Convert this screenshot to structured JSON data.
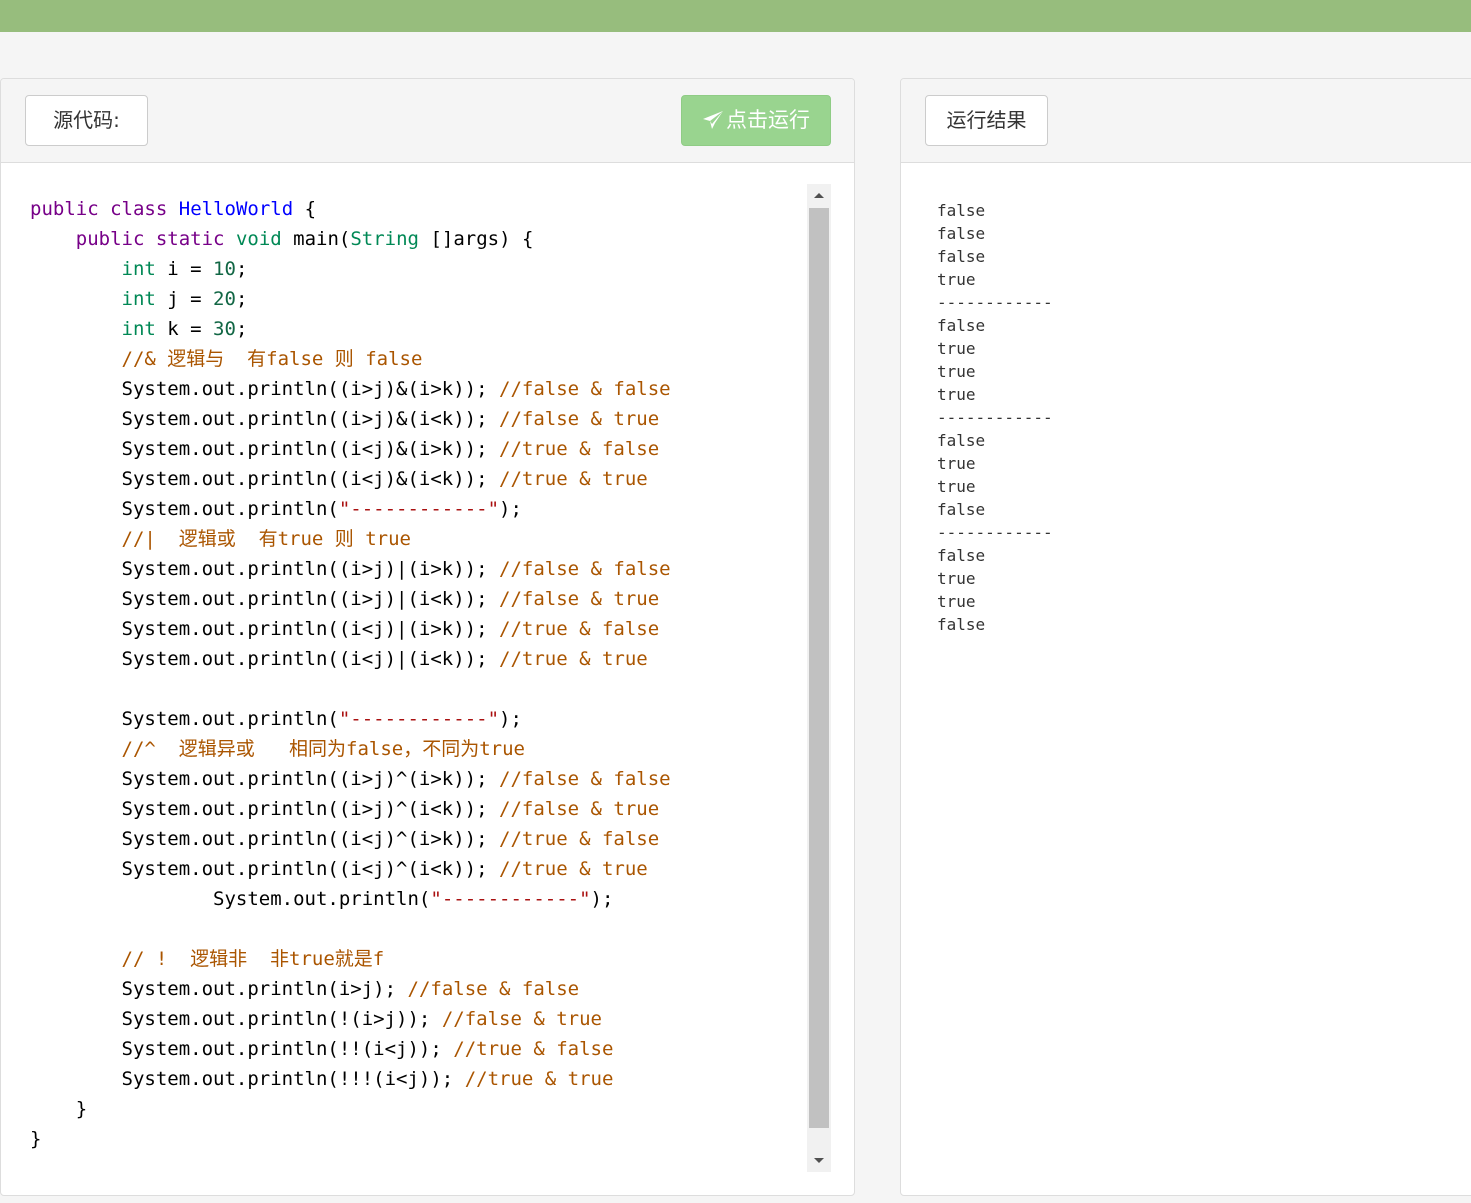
{
  "header": {
    "title": ""
  },
  "source_panel": {
    "label": "源代码:",
    "run_button": {
      "label": "点击运行",
      "icon": "paper-plane-icon"
    }
  },
  "result_panel": {
    "label": "运行结果"
  },
  "code_lines": [
    [
      [
        "k",
        "public"
      ],
      [
        "p",
        " "
      ],
      [
        "k",
        "class"
      ],
      [
        "p",
        " "
      ],
      [
        "d",
        "HelloWorld"
      ],
      [
        "p",
        " {"
      ]
    ],
    [
      [
        "p",
        "    "
      ],
      [
        "k",
        "public"
      ],
      [
        "p",
        " "
      ],
      [
        "k",
        "static"
      ],
      [
        "p",
        " "
      ],
      [
        "t",
        "void"
      ],
      [
        "p",
        " main("
      ],
      [
        "t",
        "String"
      ],
      [
        "p",
        " []args) {"
      ]
    ],
    [
      [
        "p",
        "        "
      ],
      [
        "t",
        "int"
      ],
      [
        "p",
        " i = "
      ],
      [
        "n",
        "10"
      ],
      [
        "p",
        ";"
      ]
    ],
    [
      [
        "p",
        "        "
      ],
      [
        "t",
        "int"
      ],
      [
        "p",
        " j = "
      ],
      [
        "n",
        "20"
      ],
      [
        "p",
        ";"
      ]
    ],
    [
      [
        "p",
        "        "
      ],
      [
        "t",
        "int"
      ],
      [
        "p",
        " k = "
      ],
      [
        "n",
        "30"
      ],
      [
        "p",
        ";"
      ]
    ],
    [
      [
        "p",
        "        "
      ],
      [
        "c",
        "//& 逻辑与  有false 则 false"
      ]
    ],
    [
      [
        "p",
        "        System.out.println((i>j)&(i>k)); "
      ],
      [
        "c",
        "//false & false"
      ]
    ],
    [
      [
        "p",
        "        System.out.println((i>j)&(i<k)); "
      ],
      [
        "c",
        "//false & true"
      ]
    ],
    [
      [
        "p",
        "        System.out.println((i<j)&(i>k)); "
      ],
      [
        "c",
        "//true & false"
      ]
    ],
    [
      [
        "p",
        "        System.out.println((i<j)&(i<k)); "
      ],
      [
        "c",
        "//true & true"
      ]
    ],
    [
      [
        "p",
        "        System.out.println("
      ],
      [
        "s",
        "\"------------\""
      ],
      [
        "p",
        ");"
      ]
    ],
    [
      [
        "p",
        "        "
      ],
      [
        "c",
        "//|  逻辑或  有true 则 true"
      ]
    ],
    [
      [
        "p",
        "        System.out.println((i>j)|(i>k)); "
      ],
      [
        "c",
        "//false & false"
      ]
    ],
    [
      [
        "p",
        "        System.out.println((i>j)|(i<k)); "
      ],
      [
        "c",
        "//false & true"
      ]
    ],
    [
      [
        "p",
        "        System.out.println((i<j)|(i>k)); "
      ],
      [
        "c",
        "//true & false"
      ]
    ],
    [
      [
        "p",
        "        System.out.println((i<j)|(i<k)); "
      ],
      [
        "c",
        "//true & true"
      ]
    ],
    [
      [
        "p",
        ""
      ]
    ],
    [
      [
        "p",
        "        System.out.println("
      ],
      [
        "s",
        "\"------------\""
      ],
      [
        "p",
        ");"
      ]
    ],
    [
      [
        "p",
        "        "
      ],
      [
        "c",
        "//^  逻辑异或   相同为false，不同为true"
      ]
    ],
    [
      [
        "p",
        "        System.out.println((i>j)^(i>k)); "
      ],
      [
        "c",
        "//false & false"
      ]
    ],
    [
      [
        "p",
        "        System.out.println((i>j)^(i<k)); "
      ],
      [
        "c",
        "//false & true"
      ]
    ],
    [
      [
        "p",
        "        System.out.println((i<j)^(i>k)); "
      ],
      [
        "c",
        "//true & false"
      ]
    ],
    [
      [
        "p",
        "        System.out.println((i<j)^(i<k)); "
      ],
      [
        "c",
        "//true & true"
      ]
    ],
    [
      [
        "p",
        "                System.out.println("
      ],
      [
        "s",
        "\"------------\""
      ],
      [
        "p",
        ");"
      ]
    ],
    [
      [
        "p",
        ""
      ]
    ],
    [
      [
        "p",
        "        "
      ],
      [
        "c",
        "// !  逻辑非  非true就是f"
      ]
    ],
    [
      [
        "p",
        "        System.out.println(i>j); "
      ],
      [
        "c",
        "//false & false"
      ]
    ],
    [
      [
        "p",
        "        System.out.println(!(i>j)); "
      ],
      [
        "c",
        "//false & true"
      ]
    ],
    [
      [
        "p",
        "        System.out.println(!!(i<j)); "
      ],
      [
        "c",
        "//true & false"
      ]
    ],
    [
      [
        "p",
        "        System.out.println(!!!(i<j)); "
      ],
      [
        "c",
        "//true & true"
      ]
    ],
    [
      [
        "p",
        "    }"
      ]
    ],
    [
      [
        "p",
        "}"
      ]
    ]
  ],
  "output_lines": [
    "false",
    "false",
    "false",
    "true",
    "------------",
    "false",
    "true",
    "true",
    "true",
    "------------",
    "false",
    "true",
    "true",
    "false",
    "------------",
    "false",
    "true",
    "true",
    "false"
  ],
  "colors": {
    "header_bar": "#97bd7d",
    "run_button": "#99d48f",
    "keyword": "#770088",
    "type": "#008855",
    "class_name": "#0000ff",
    "number": "#116644",
    "comment": "#aa5500",
    "string": "#aa1111"
  }
}
